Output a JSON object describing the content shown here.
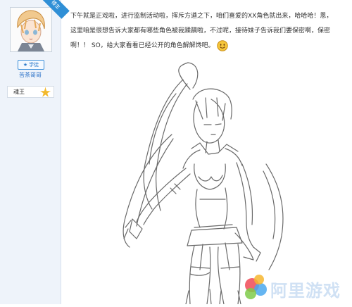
{
  "user": {
    "ribbon_text": "楼主",
    "level_badge": "学徒",
    "name": "苦茶哥哥",
    "rank": "魂王"
  },
  "post": {
    "text": "下午就是正戏啦，进行监制活动啦，挥斥方遒之下，咱们喜爱的XX角色就出来，哈哈哈！恩，这里咱是很想告诉大家都有哪些角色被我蹂躏啦，不过呢，接待妹子告诉我们要保密啊，保密啊！！ SO，给大家看看已经公开的角色解解馋吧。",
    "emoticon": "smile-emoticon"
  },
  "watermark": {
    "text": "阿里游戏"
  },
  "colors": {
    "sidebar_bg": "#eef3fa",
    "accent_blue": "#2e73c8",
    "medal_gold": "#f3b92b"
  }
}
